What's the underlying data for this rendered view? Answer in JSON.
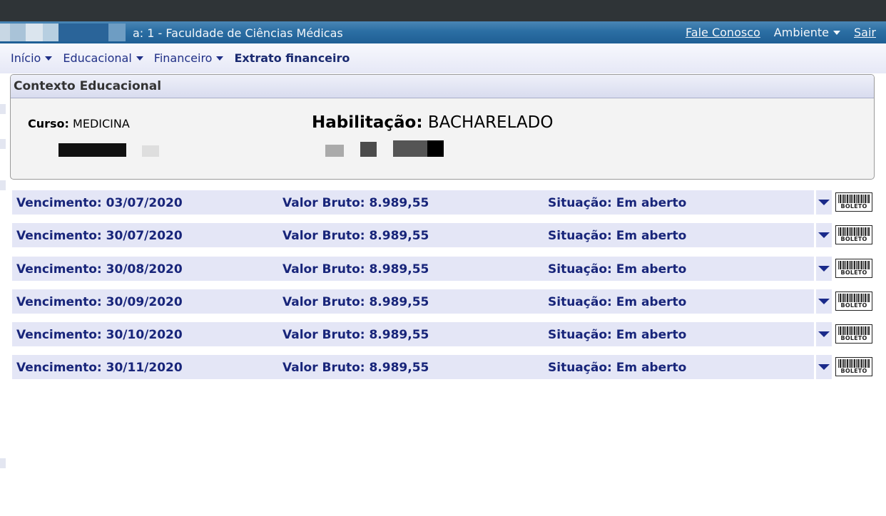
{
  "header": {
    "title": "a: 1 - Faculdade de Ciências Médicas",
    "contact_link": "Fale Conosco",
    "environment_menu": "Ambiente",
    "logout_link": "Sair"
  },
  "nav": {
    "items": [
      {
        "label": "Início"
      },
      {
        "label": "Educacional"
      },
      {
        "label": "Financeiro"
      },
      {
        "label": "Extrato financeiro"
      }
    ]
  },
  "context": {
    "heading": "Contexto Educacional",
    "curso_label": "Curso:",
    "curso_value": "MEDICINA",
    "habilitacao_label": "Habilitação:",
    "habilitacao_value": "BACHARELADO"
  },
  "installments": [
    {
      "vencimento": "Vencimento: 03/07/2020",
      "valor": "Valor Bruto: 8.989,55",
      "situacao": "Situação: Em aberto",
      "boleto": "BOLETO"
    },
    {
      "vencimento": "Vencimento: 30/07/2020",
      "valor": "Valor Bruto: 8.989,55",
      "situacao": "Situação: Em aberto",
      "boleto": "BOLETO"
    },
    {
      "vencimento": "Vencimento: 30/08/2020",
      "valor": "Valor Bruto: 8.989,55",
      "situacao": "Situação: Em aberto",
      "boleto": "BOLETO"
    },
    {
      "vencimento": "Vencimento: 30/09/2020",
      "valor": "Valor Bruto: 8.989,55",
      "situacao": "Situação: Em aberto",
      "boleto": "BOLETO"
    },
    {
      "vencimento": "Vencimento: 30/10/2020",
      "valor": "Valor Bruto: 8.989,55",
      "situacao": "Situação: Em aberto",
      "boleto": "BOLETO"
    },
    {
      "vencimento": "Vencimento: 30/11/2020",
      "valor": "Valor Bruto: 8.989,55",
      "situacao": "Situação: Em aberto",
      "boleto": "BOLETO"
    }
  ],
  "colors": {
    "header_blue": "#2b6ea3",
    "nav_text": "#1f2f86",
    "row_background": "#e4e6f6",
    "row_text": "#18257a"
  },
  "icons": {
    "nav_dropdown": "caret-down-icon",
    "row_expand": "triangle-down-icon",
    "boleto": "barcode-icon"
  }
}
